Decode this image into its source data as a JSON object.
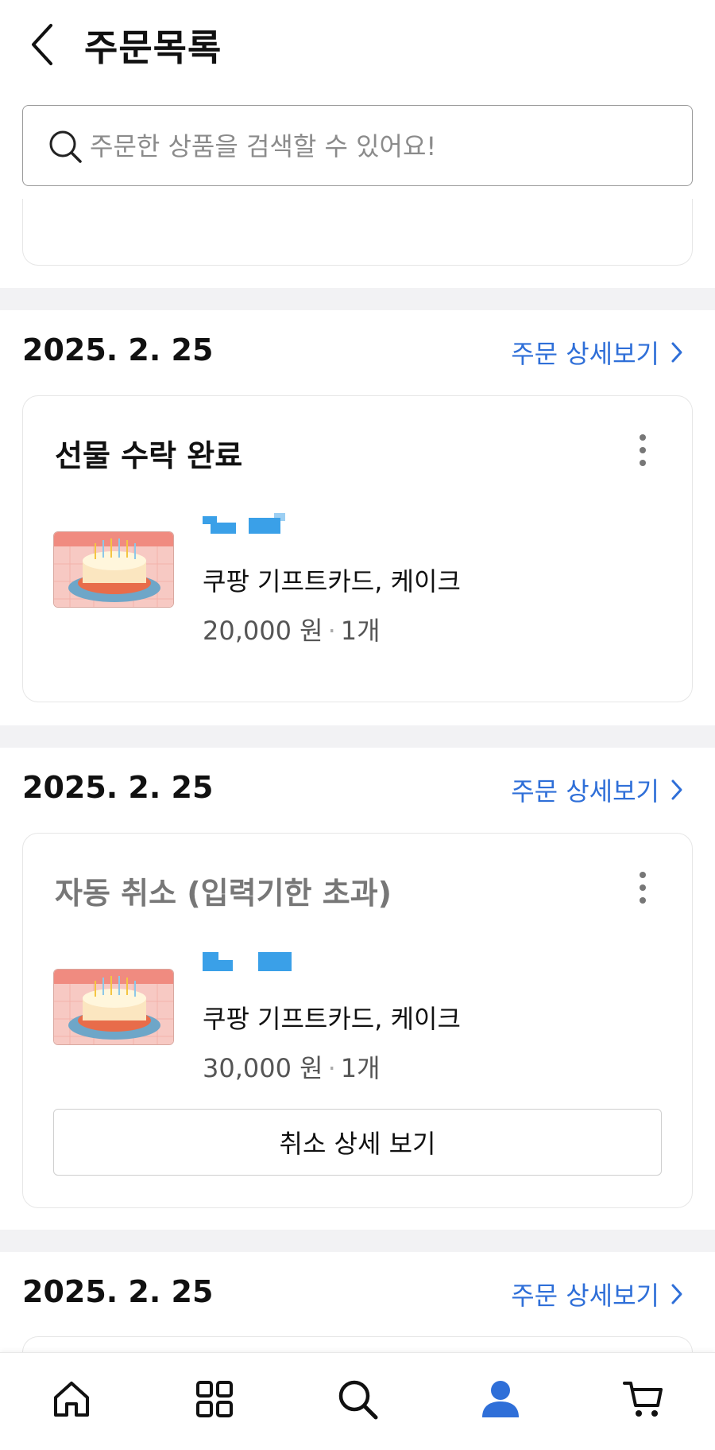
{
  "header": {
    "title": "주문목록"
  },
  "search": {
    "placeholder": "주문한 상품을 검색할 수 있어요!"
  },
  "orders": [
    {
      "date": "2025. 2. 25",
      "detail_link": "주문 상세보기",
      "status": "선물 수락 완료",
      "product_name": "쿠팡 기프트카드, 케이크",
      "price": "20,000 원",
      "quantity": "1개"
    },
    {
      "date": "2025. 2. 25",
      "detail_link": "주문 상세보기",
      "status": "자동 취소 (입력기한 초과)",
      "product_name": "쿠팡 기프트카드, 케이크",
      "price": "30,000 원",
      "quantity": "1개",
      "cancel_button": "취소 상세 보기"
    },
    {
      "date": "2025. 2. 25",
      "detail_link": "주문 상세보기"
    }
  ],
  "nav": {
    "items": [
      "home-icon",
      "category-grid-icon",
      "search-icon",
      "my-account-icon",
      "cart-icon"
    ],
    "active": "my-account-icon",
    "active_color": "#2f6fd8"
  },
  "colors": {
    "link": "#2f6fd8",
    "separator": "#f2f2f4"
  }
}
